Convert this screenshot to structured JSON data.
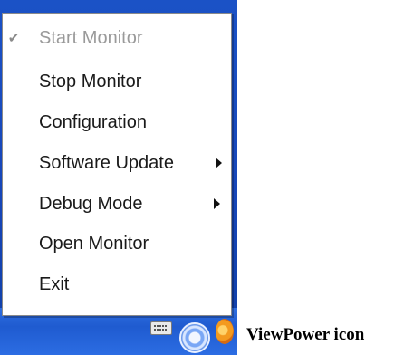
{
  "menu": {
    "items": [
      {
        "label": "Start Monitor",
        "checked": true,
        "disabled": true,
        "submenu": false
      },
      {
        "label": "Stop Monitor",
        "checked": false,
        "disabled": false,
        "submenu": false
      },
      {
        "label": "Configuration",
        "checked": false,
        "disabled": false,
        "submenu": false
      },
      {
        "label": "Software Update",
        "checked": false,
        "disabled": false,
        "submenu": true
      },
      {
        "label": "Debug Mode",
        "checked": false,
        "disabled": false,
        "submenu": true
      },
      {
        "label": "Open Monitor",
        "checked": false,
        "disabled": false,
        "submenu": false
      },
      {
        "label": "Exit",
        "checked": false,
        "disabled": false,
        "submenu": false
      }
    ]
  },
  "caption": "ViewPower icon",
  "icons": {
    "check": "check-icon",
    "submenu_arrow": "chevron-right-icon",
    "keyboard": "keyboard-icon",
    "viewpower": "viewpower-icon",
    "tray_app": "tray-app-icon"
  },
  "colors": {
    "taskbar": "#1b52c6",
    "menu_bg": "#ffffff",
    "disabled_text": "#9a9a9a"
  }
}
